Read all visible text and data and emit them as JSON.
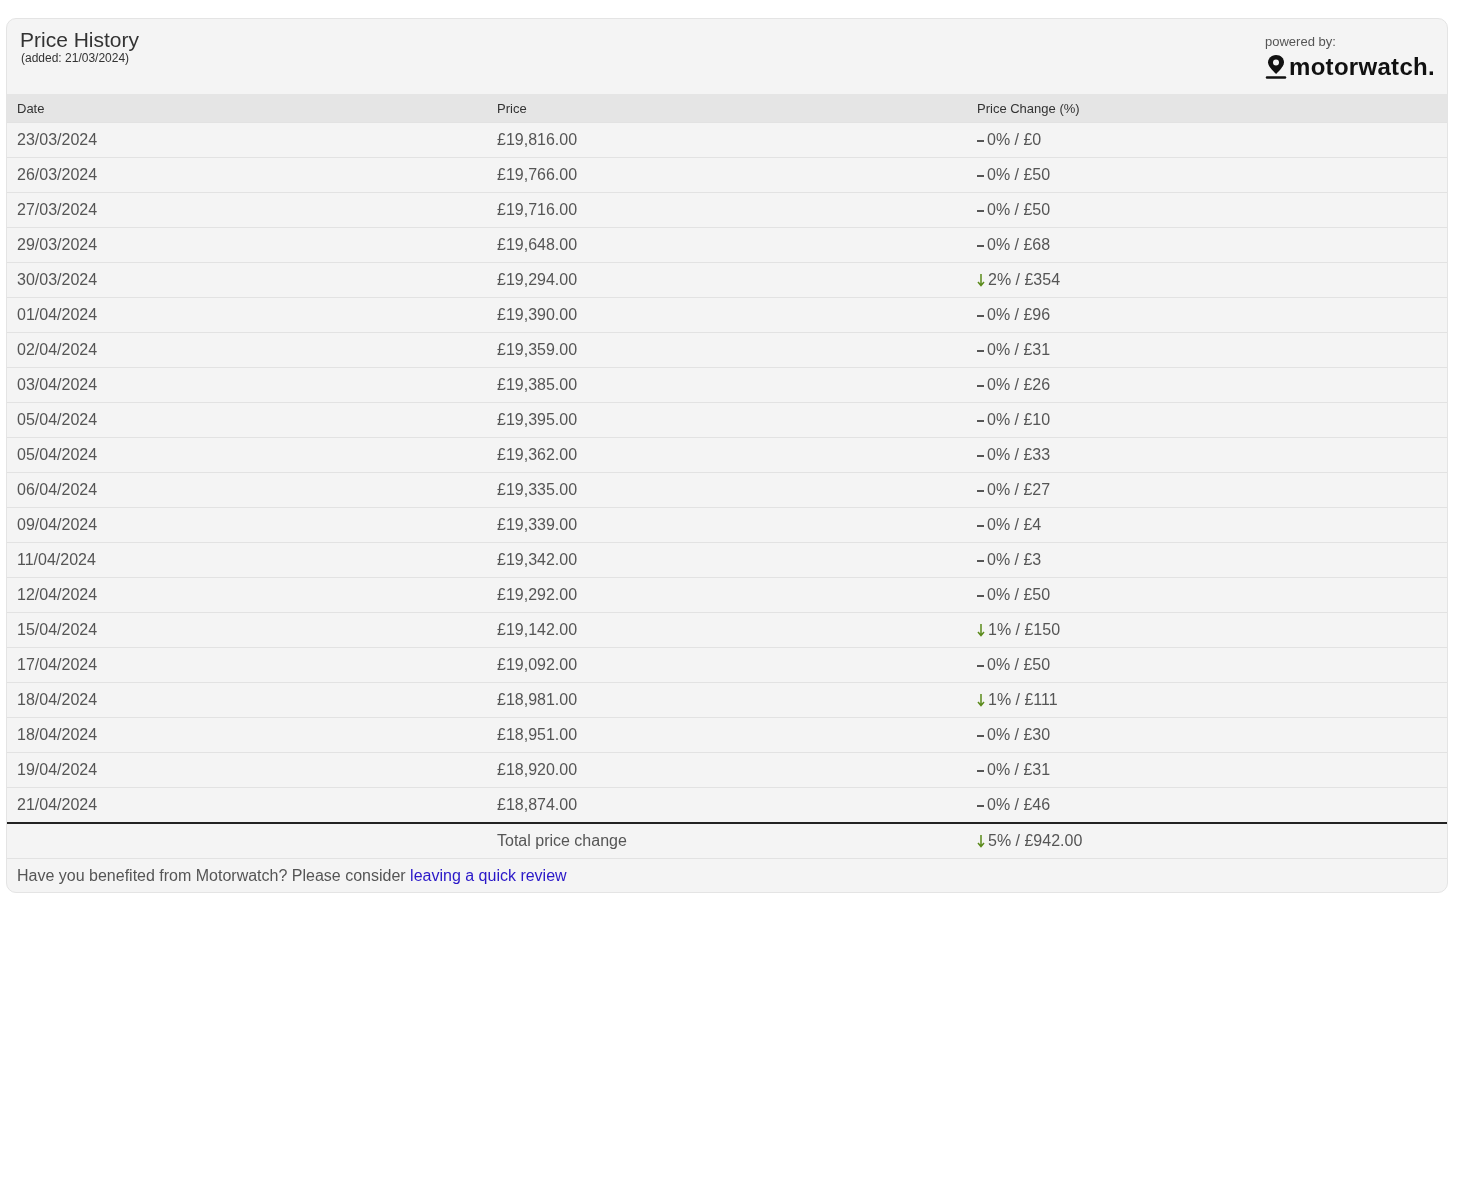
{
  "header": {
    "title": "Price History",
    "subtitle": "(added: 21/03/2024)",
    "powered_by": "powered by:",
    "logo_text": "motorwatch."
  },
  "table": {
    "columns": [
      "Date",
      "Price",
      "Price Change (%)"
    ],
    "rows": [
      {
        "date": "23/03/2024",
        "price": "£19,816.00",
        "kind": "flat",
        "change": "0% / £0"
      },
      {
        "date": "26/03/2024",
        "price": "£19,766.00",
        "kind": "flat",
        "change": "0% / £50"
      },
      {
        "date": "27/03/2024",
        "price": "£19,716.00",
        "kind": "flat",
        "change": "0% / £50"
      },
      {
        "date": "29/03/2024",
        "price": "£19,648.00",
        "kind": "flat",
        "change": "0% / £68"
      },
      {
        "date": "30/03/2024",
        "price": "£19,294.00",
        "kind": "down",
        "change": "2% / £354"
      },
      {
        "date": "01/04/2024",
        "price": "£19,390.00",
        "kind": "flat",
        "change": "0% / £96"
      },
      {
        "date": "02/04/2024",
        "price": "£19,359.00",
        "kind": "flat",
        "change": "0% / £31"
      },
      {
        "date": "03/04/2024",
        "price": "£19,385.00",
        "kind": "flat",
        "change": "0% / £26"
      },
      {
        "date": "05/04/2024",
        "price": "£19,395.00",
        "kind": "flat",
        "change": "0% / £10"
      },
      {
        "date": "05/04/2024",
        "price": "£19,362.00",
        "kind": "flat",
        "change": "0% / £33"
      },
      {
        "date": "06/04/2024",
        "price": "£19,335.00",
        "kind": "flat",
        "change": "0% / £27"
      },
      {
        "date": "09/04/2024",
        "price": "£19,339.00",
        "kind": "flat",
        "change": "0% / £4"
      },
      {
        "date": "11/04/2024",
        "price": "£19,342.00",
        "kind": "flat",
        "change": "0% / £3"
      },
      {
        "date": "12/04/2024",
        "price": "£19,292.00",
        "kind": "flat",
        "change": "0% / £50"
      },
      {
        "date": "15/04/2024",
        "price": "£19,142.00",
        "kind": "down",
        "change": "1% / £150"
      },
      {
        "date": "17/04/2024",
        "price": "£19,092.00",
        "kind": "flat",
        "change": "0% / £50"
      },
      {
        "date": "18/04/2024",
        "price": "£18,981.00",
        "kind": "down",
        "change": "1% / £111"
      },
      {
        "date": "18/04/2024",
        "price": "£18,951.00",
        "kind": "flat",
        "change": "0% / £30"
      },
      {
        "date": "19/04/2024",
        "price": "£18,920.00",
        "kind": "flat",
        "change": "0% / £31"
      },
      {
        "date": "21/04/2024",
        "price": "£18,874.00",
        "kind": "flat",
        "change": "0% / £46"
      }
    ],
    "total": {
      "label": "Total price change",
      "kind": "down",
      "change": "5% / £942.00"
    }
  },
  "footer": {
    "text": "Have you benefited from Motorwatch? Please consider",
    "link": "leaving a quick review"
  }
}
